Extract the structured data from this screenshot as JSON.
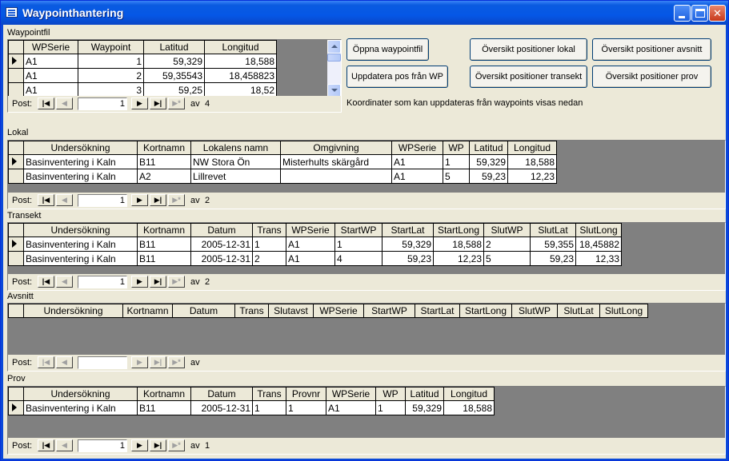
{
  "window": {
    "title": "Waypointhantering"
  },
  "nav": {
    "post_label": "Post:",
    "of_label": "av"
  },
  "waypointfil": {
    "label": "Waypointfil",
    "columns": [
      "WPSerie",
      "Waypoint",
      "Latitud",
      "Longitud"
    ],
    "rows": [
      [
        "A1",
        "1",
        "59,329",
        "18,588"
      ],
      [
        "A1",
        "2",
        "59,35543",
        "18,458823"
      ],
      [
        "A1",
        "3",
        "59,25",
        "18,52"
      ]
    ],
    "current": "1",
    "total": "4"
  },
  "buttons": {
    "open_file": "Öppna waypointfil",
    "update_pos": "Uppdatera pos från WP",
    "overview_local": "Översikt positioner lokal",
    "overview_section": "Översikt positioner avsnitt",
    "overview_transect": "Översikt positioner transekt",
    "overview_sample": "Översikt positioner prov"
  },
  "info_text": "Koordinater som kan uppdateras från waypoints visas nedan",
  "lokal": {
    "label": "Lokal",
    "columns": [
      "Undersökning",
      "Kortnamn",
      "Lokalens namn",
      "Omgivning",
      "WPSerie",
      "WP",
      "Latitud",
      "Longitud"
    ],
    "rows": [
      [
        "Basinventering i Kaln",
        "B11",
        "NW Stora Ön",
        "Misterhults skärgård",
        "A1",
        "1",
        "59,329",
        "18,588"
      ],
      [
        "Basinventering i Kaln",
        "A2",
        "Lillrevet",
        "",
        "A1",
        "5",
        "59,23",
        "12,23"
      ]
    ],
    "current": "1",
    "total": "2"
  },
  "transekt": {
    "label": "Transekt",
    "columns": [
      "Undersökning",
      "Kortnamn",
      "Datum",
      "Trans",
      "WPSerie",
      "StartWP",
      "StartLat",
      "StartLong",
      "SlutWP",
      "SlutLat",
      "SlutLong"
    ],
    "rows": [
      [
        "Basinventering i Kaln",
        "B11",
        "2005-12-31",
        "1",
        "A1",
        "1",
        "59,329",
        "18,588",
        "2",
        "59,355",
        "18,45882"
      ],
      [
        "Basinventering i Kaln",
        "B11",
        "2005-12-31",
        "2",
        "A1",
        "4",
        "59,23",
        "12,23",
        "5",
        "59,23",
        "12,33"
      ]
    ],
    "current": "1",
    "total": "2"
  },
  "avsnitt": {
    "label": "Avsnitt",
    "columns": [
      "Undersökning",
      "Kortnamn",
      "Datum",
      "Trans",
      "Slutavst",
      "WPSerie",
      "StartWP",
      "StartLat",
      "StartLong",
      "SlutWP",
      "SlutLat",
      "SlutLong"
    ],
    "current": "",
    "total": ""
  },
  "prov": {
    "label": "Prov",
    "columns": [
      "Undersökning",
      "Kortnamn",
      "Datum",
      "Trans",
      "Provnr",
      "WPSerie",
      "WP",
      "Latitud",
      "Longitud"
    ],
    "rows": [
      [
        "Basinventering i Kaln",
        "B11",
        "2005-12-31",
        "1",
        "1",
        "A1",
        "1",
        "59,329",
        "18,588"
      ]
    ],
    "current": "1",
    "total": "1"
  }
}
